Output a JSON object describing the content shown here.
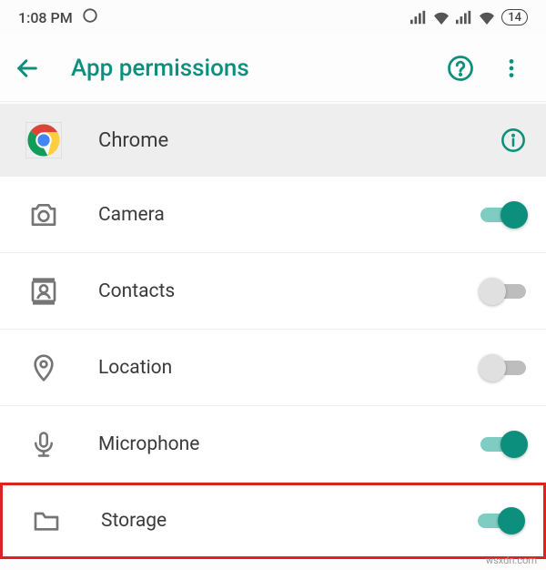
{
  "status": {
    "time": "1:08 PM",
    "battery_percent": "14"
  },
  "header": {
    "title": "App permissions"
  },
  "app": {
    "name": "Chrome"
  },
  "permissions": [
    {
      "key": "camera",
      "label": "Camera",
      "icon": "camera-icon",
      "enabled": true,
      "highlight": false
    },
    {
      "key": "contacts",
      "label": "Contacts",
      "icon": "contacts-icon",
      "enabled": false,
      "highlight": false
    },
    {
      "key": "location",
      "label": "Location",
      "icon": "location-icon",
      "enabled": false,
      "highlight": false
    },
    {
      "key": "microphone",
      "label": "Microphone",
      "icon": "microphone-icon",
      "enabled": true,
      "highlight": false
    },
    {
      "key": "storage",
      "label": "Storage",
      "icon": "storage-icon",
      "enabled": true,
      "highlight": true
    }
  ],
  "colors": {
    "accent": "#0d8f7d",
    "highlight_border": "#d22"
  },
  "watermark": "wsxdn.com"
}
